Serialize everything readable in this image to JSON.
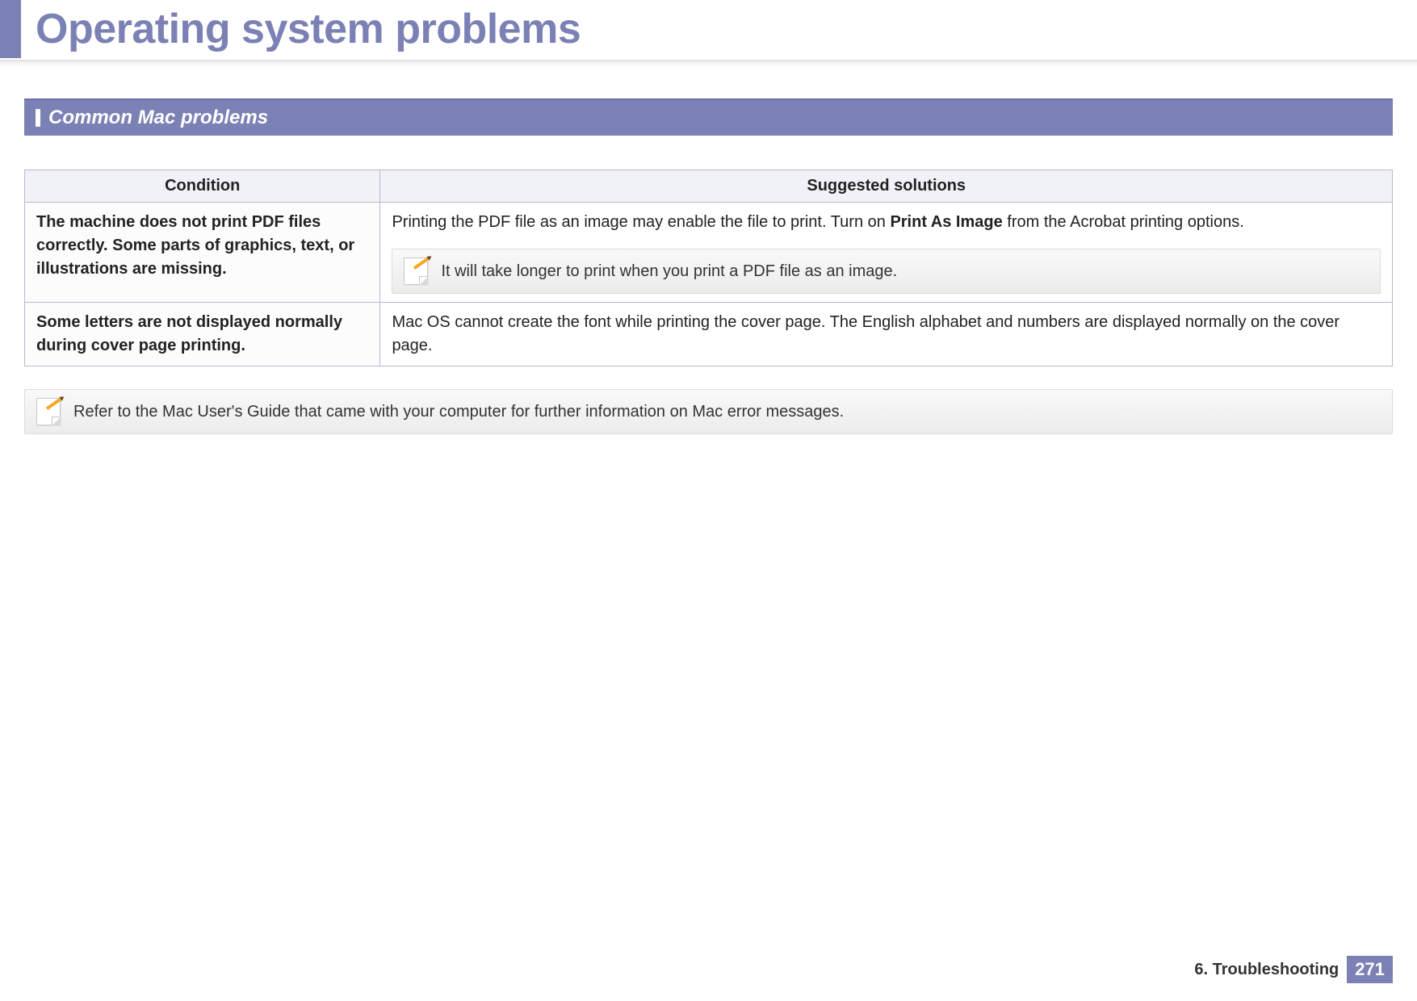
{
  "header": {
    "title": "Operating system problems"
  },
  "section": {
    "title": "Common Mac problems"
  },
  "table": {
    "headers": {
      "condition": "Condition",
      "solutions": "Suggested solutions"
    },
    "rows": [
      {
        "condition": "The machine does not print PDF files correctly. Some parts of graphics, text, or illustrations are missing.",
        "solution_pre": "Printing the PDF file as an image may enable the file to print. Turn on ",
        "solution_bold": "Print As Image",
        "solution_post": " from the Acrobat printing options.",
        "note": "It will take longer to print when you print a PDF file as an image."
      },
      {
        "condition": "Some letters are not displayed normally during cover page printing.",
        "solution_pre": "Mac OS cannot create the font while printing the cover page. The English alphabet and numbers are displayed normally on the cover page.",
        "solution_bold": "",
        "solution_post": "",
        "note": ""
      }
    ]
  },
  "page_note": "Refer to the Mac User's Guide that came with your computer for further information on Mac error messages.",
  "footer": {
    "chapter": "6.  Troubleshooting",
    "page": "271"
  }
}
